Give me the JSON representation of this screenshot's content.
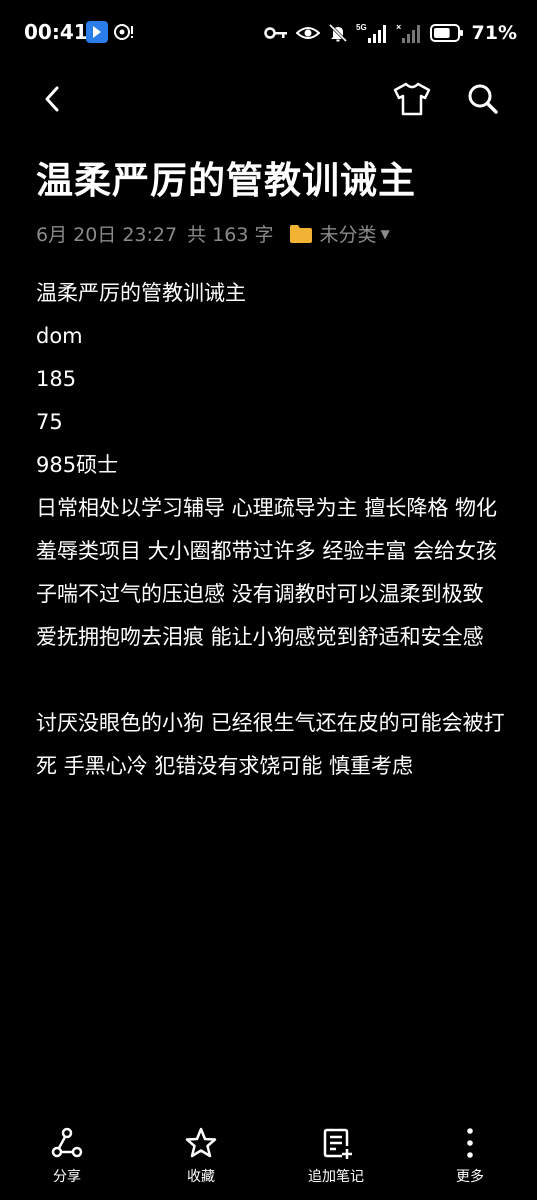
{
  "status_bar": {
    "time": "00:41",
    "network": "5G",
    "battery_percent": 71,
    "battery_label": "71%"
  },
  "top_bar": {
    "back_icon": "chevron-left-icon",
    "theme_icon": "tshirt-icon",
    "search_icon": "search-icon"
  },
  "note": {
    "title": "温柔严厉的管教训诫主",
    "date": "6月 20日 23:27",
    "word_count": "共 163 字",
    "folder": "未分类",
    "paragraphs": [
      "温柔严厉的管教训诫主",
      "dom",
      "185",
      "75",
      "985硕士",
      "日常相处以学习辅导 心理疏导为主 擅长降格 物化 羞辱类项目 大小圈都带过许多 经验丰富  会给女孩子喘不过气的压迫感 没有调教时可以温柔到极致  爱抚拥抱吻去泪痕 能让小狗感觉到舒适和安全感",
      "",
      "讨厌没眼色的小狗 已经很生气还在皮的可能会被打死 手黑心冷 犯错没有求饶可能 慎重考虑"
    ]
  },
  "bottom_bar": {
    "share": "分享",
    "favorite": "收藏",
    "add_note": "追加笔记",
    "more": "更多"
  }
}
